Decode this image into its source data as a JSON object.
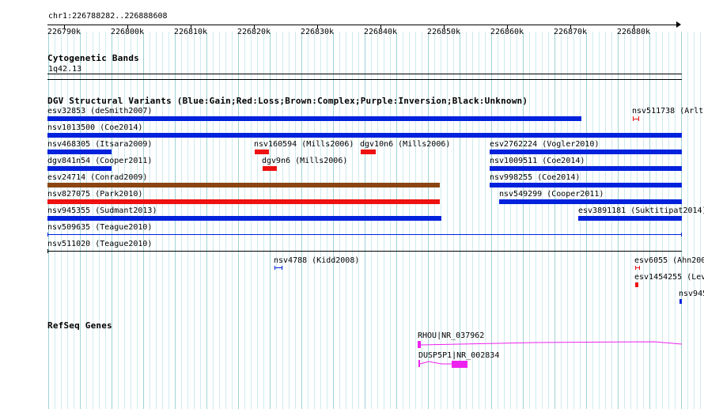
{
  "ruler": {
    "location": "chr1:226788282..226888608",
    "ticks": [
      "226790k",
      "226800k",
      "226810k",
      "226820k",
      "226830k",
      "226840k",
      "226850k",
      "226860k",
      "226870k",
      "226880k"
    ]
  },
  "colors": {
    "gain": "#0022dd",
    "loss": "#ee1111",
    "complex": "#8b4513",
    "gene": "#ee22ee",
    "grid_major": "#9fd3d6",
    "grid_minor": "#cfeaf0"
  },
  "cytoband": {
    "title": "Cytogenetic Bands",
    "band": "1q42.13"
  },
  "dgv": {
    "title": "DGV Structural Variants (Blue:Gain;Red:Loss;Brown:Complex;Purple:Inversion;Black:Unknown)",
    "features": [
      {
        "id": "esv32853",
        "label": "esv32853 (deSmith2007)",
        "type": "gain"
      },
      {
        "id": "nsv511738",
        "label": "nsv511738 (Arlt",
        "type": "loss"
      },
      {
        "id": "nsv1013500",
        "label": "nsv1013500 (Coe2014)",
        "type": "gain"
      },
      {
        "id": "nsv468305",
        "label": "nsv468305 (Itsara2009)",
        "type": "gain"
      },
      {
        "id": "nsv160594",
        "label": "nsv160594 (Mills2006)",
        "type": "loss"
      },
      {
        "id": "dgv10n6",
        "label": "dgv10n6 (Mills2006)",
        "type": "loss"
      },
      {
        "id": "esv2762224",
        "label": "esv2762224 (Vogler2010)",
        "type": "gain"
      },
      {
        "id": "dgv841n54",
        "label": "dgv841n54 (Cooper2011)",
        "type": "gain"
      },
      {
        "id": "dgv9n6",
        "label": "dgv9n6 (Mills2006)",
        "type": "loss"
      },
      {
        "id": "nsv1009511",
        "label": "nsv1009511 (Coe2014)",
        "type": "gain"
      },
      {
        "id": "esv24714",
        "label": "esv24714 (Conrad2009)",
        "type": "complex"
      },
      {
        "id": "nsv998255",
        "label": "nsv998255 (Coe2014)",
        "type": "gain"
      },
      {
        "id": "nsv827075",
        "label": "nsv827075 (Park2010)",
        "type": "loss"
      },
      {
        "id": "nsv549299",
        "label": "nsv549299 (Cooper2011)",
        "type": "gain"
      },
      {
        "id": "nsv945355",
        "label": "nsv945355 (Sudmant2013)",
        "type": "gain"
      },
      {
        "id": "esv3891181",
        "label": "esv3891181 (Suktitipat2014)",
        "type": "gain"
      },
      {
        "id": "nsv509635",
        "label": "nsv509635 (Teague2010)",
        "type": "gain"
      },
      {
        "id": "nsv511020",
        "label": "nsv511020 (Teague2010)",
        "type": "unknown"
      },
      {
        "id": "nsv4788",
        "label": "nsv4788 (Kidd2008)",
        "type": "gain"
      },
      {
        "id": "esv6055",
        "label": "esv6055 (Ahn200",
        "type": "loss"
      },
      {
        "id": "esv1454255",
        "label": "esv1454255 (Lev",
        "type": "loss"
      },
      {
        "id": "nsv945",
        "label": "nsv945",
        "type": "gain"
      }
    ]
  },
  "refseq": {
    "title": "RefSeq Genes",
    "genes": [
      {
        "id": "RHOU",
        "label": "RHOU|NR_037962"
      },
      {
        "id": "DUSP5P1",
        "label": "DUSP5P1|NR_002834"
      }
    ]
  }
}
